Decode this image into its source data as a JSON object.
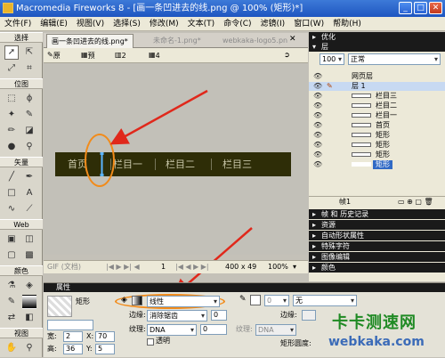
{
  "window": {
    "title": "Macromedia Fireworks 8 - [画一条凹进去的线.png @ 100% (矩形)*]"
  },
  "menu": [
    "文件(F)",
    "编辑(E)",
    "视图(V)",
    "选择(S)",
    "修改(M)",
    "文本(T)",
    "命令(C)",
    "滤镜(I)",
    "窗口(W)",
    "帮助(H)"
  ],
  "tools": {
    "select_header": "选择",
    "bitmap_header": "位图",
    "vector_header": "矢量",
    "web_header": "Web",
    "colors_header": "颜色",
    "view_header": "视图"
  },
  "doc_tabs": [
    "画一条凹进去的线.png*",
    "未命名-1.png*",
    "webkaka-logo5.pn"
  ],
  "doc_toolbar": {
    "original": "原始",
    "preview": "预览",
    "two_up": "2 幅",
    "four_up": "4 幅"
  },
  "navbar": {
    "items": [
      "首页",
      "栏目一",
      "栏目二",
      "栏目三"
    ],
    "bg": "#2e2d07"
  },
  "doc_status": {
    "gif": "GIF (文档)",
    "page": "1",
    "size": "400 x 49",
    "zoom": "100%"
  },
  "panels": {
    "optimize": "优化",
    "layers": "层",
    "opacity": "100",
    "blend": "正常",
    "layer_rows": [
      "网页层",
      "层 1",
      "栏目三",
      "栏目二",
      "栏目一",
      "首页",
      "矩形",
      "矩形",
      "矩形",
      "矩形"
    ],
    "frame": "帧1",
    "collapsed": [
      "帧 和 历史记录",
      "资源",
      "自动形状属性",
      "特殊字符",
      "图像编辑",
      "颜色"
    ]
  },
  "props": {
    "title": "属性",
    "object": "矩形",
    "fill_type": "线性",
    "edge_label": "边缘:",
    "edge_value": "消除锯齿",
    "edge_num": "0",
    "texture_label": "纹理:",
    "texture_value": "DNA",
    "texture_num": "0",
    "transparent": "透明",
    "stroke_value": "0",
    "stroke_type": "无",
    "stroke_edge_label": "边缘:",
    "stroke_texture_label": "纹理:",
    "stroke_texture_value": "DNA",
    "rect_roundness": "矩形圆度:",
    "w_label": "宽:",
    "w": "2",
    "h_label": "高:",
    "h": "36",
    "x_label": "X:",
    "x": "70",
    "y_label": "Y:",
    "y": "5"
  },
  "watermark": {
    "title": "卡卡测速网",
    "url": "webkaka.com"
  },
  "colors": {
    "oval": "#f28b1a",
    "arrow": "#e0281b",
    "cursor": "#5ab4ff"
  }
}
